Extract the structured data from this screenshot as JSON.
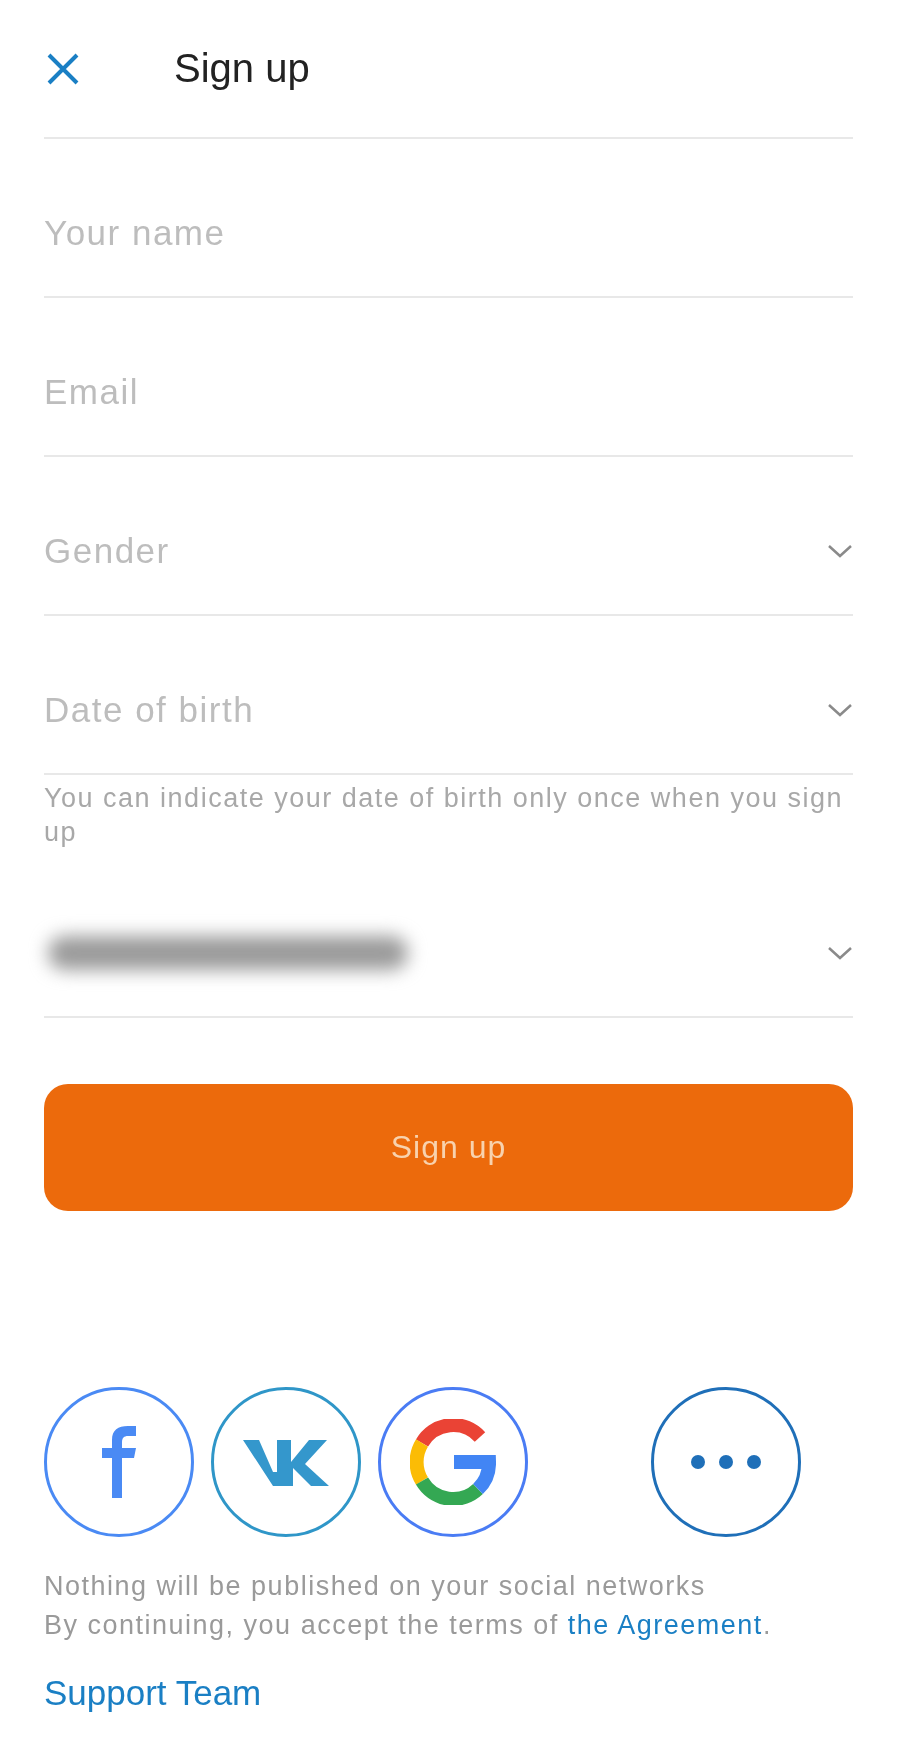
{
  "header": {
    "title": "Sign up"
  },
  "fields": [
    {
      "kind": "text",
      "placeholder": "Your name"
    },
    {
      "kind": "text",
      "placeholder": "Email"
    },
    {
      "kind": "select",
      "placeholder": "Gender"
    },
    {
      "kind": "select",
      "placeholder": "Date of birth",
      "hint": "You can indicate your date of birth only once when you sign up"
    },
    {
      "kind": "redacted"
    }
  ],
  "submit_button": {
    "label": "Sign up"
  },
  "social_buttons": [
    {
      "kind": "facebook"
    },
    {
      "kind": "vk"
    },
    {
      "kind": "google"
    },
    {
      "kind": "more"
    }
  ],
  "notice": "Nothing will be published on your social networks",
  "consent": {
    "text": "By continuing, you accept the terms of ",
    "link": "the Agreement",
    "end": "."
  },
  "support_link": "Support Team"
}
